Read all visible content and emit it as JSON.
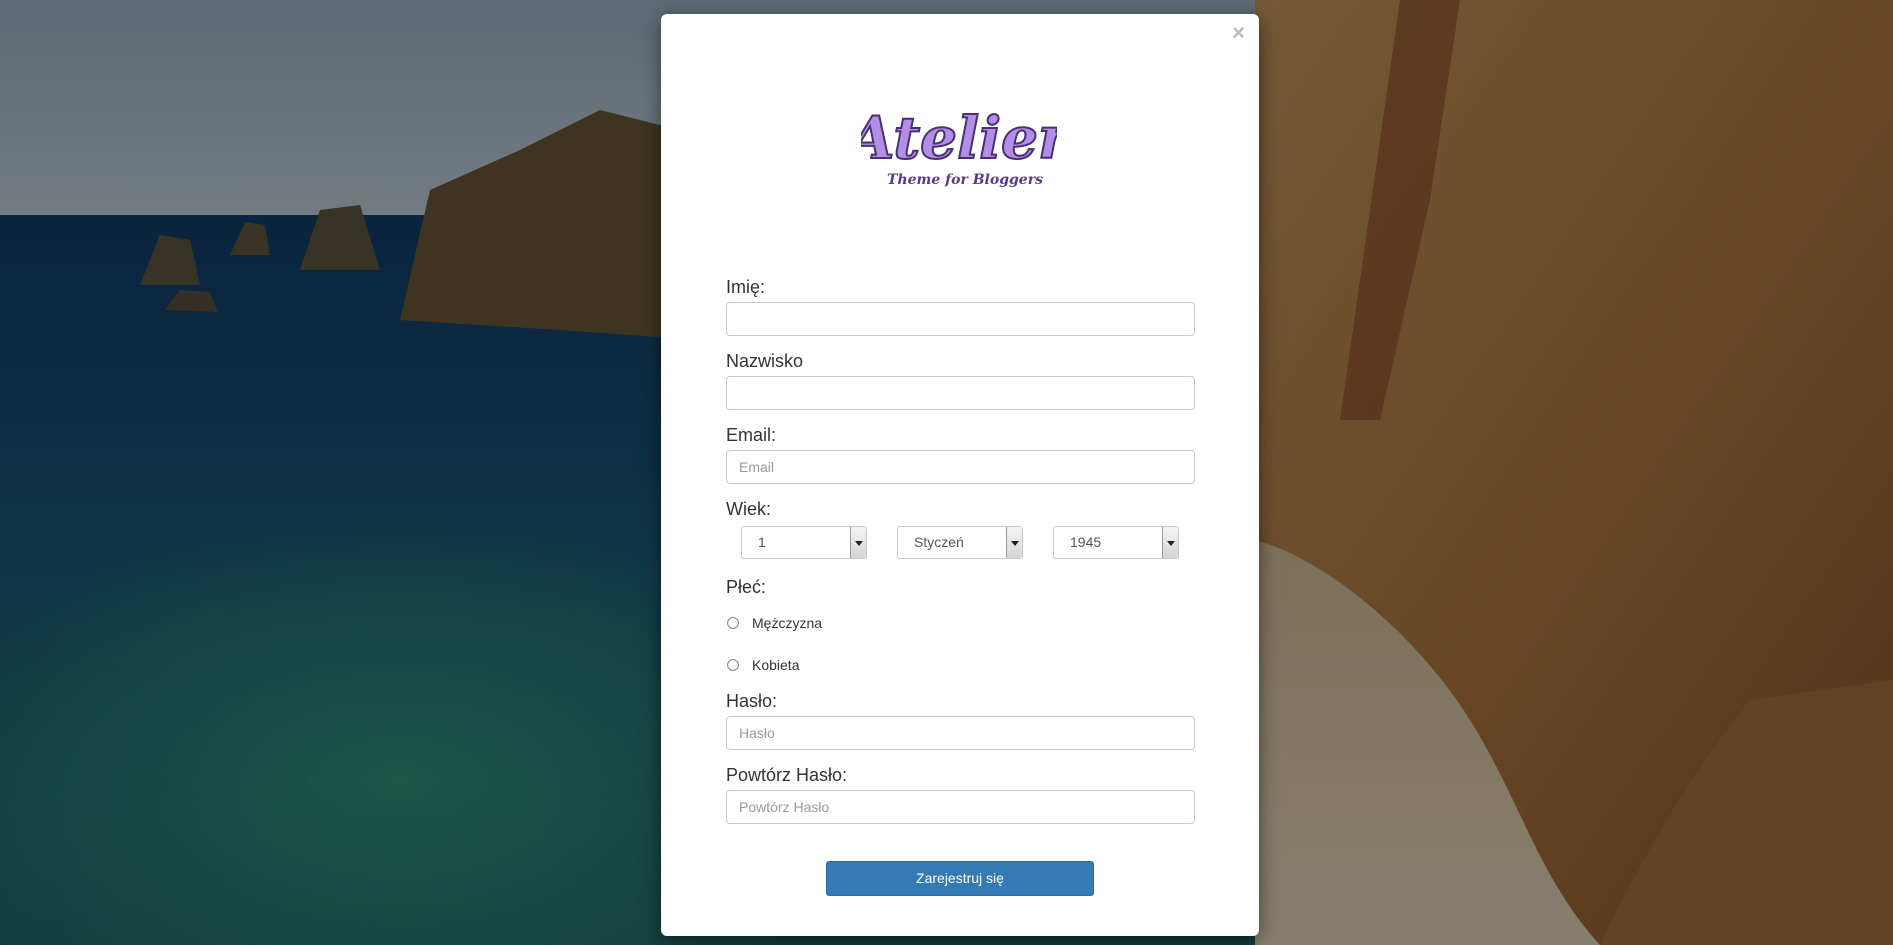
{
  "modal": {
    "close_label": "×",
    "logo_text": "Atelier",
    "logo_subtitle": "Theme for Bloggers",
    "colors": {
      "logo_purple": "#b38ee6",
      "logo_dark": "#5a3a8a",
      "button_blue": "#337ab7"
    }
  },
  "form": {
    "first_name": {
      "label": "Imię:",
      "value": "",
      "placeholder": ""
    },
    "last_name": {
      "label": "Nazwisko",
      "value": "",
      "placeholder": ""
    },
    "email": {
      "label": "Email:",
      "value": "",
      "placeholder": "Email"
    },
    "age": {
      "label": "Wiek:",
      "day": "1",
      "month": "Styczeń",
      "year": "1945"
    },
    "gender": {
      "label": "Płeć:",
      "options": [
        "Mężczyzna",
        "Kobieta"
      ]
    },
    "password": {
      "label": "Hasło:",
      "value": "",
      "placeholder": "Hasło"
    },
    "repeat_password": {
      "label": "Powtórz Hasło:",
      "value": "",
      "placeholder": "Powtórz Hasło"
    },
    "submit_label": "Zarejestruj się"
  }
}
